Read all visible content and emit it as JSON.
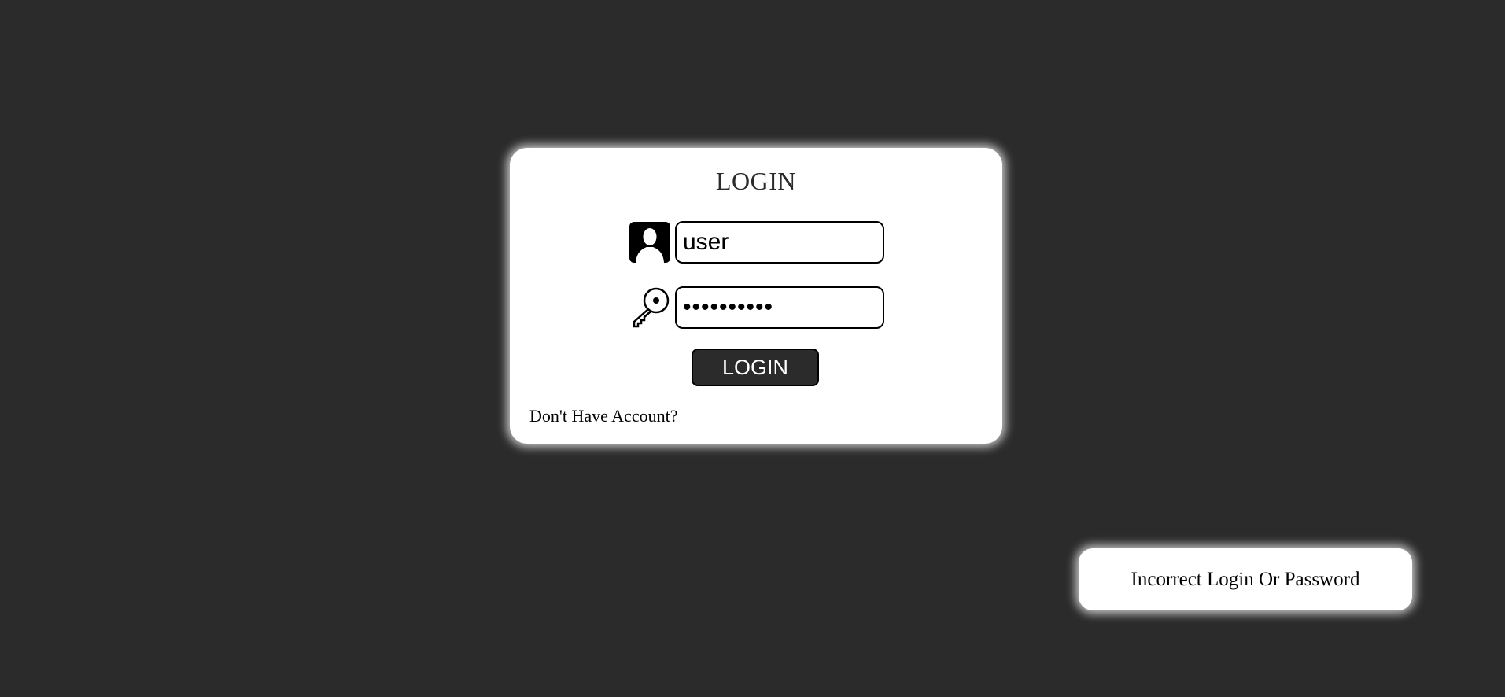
{
  "login_form": {
    "title": "LOGIN",
    "username_icon": "user-silhouette-icon",
    "username_value": "user",
    "password_icon": "key-icon",
    "password_value": "••••••••••",
    "submit_label": "LOGIN",
    "signup_link": "Don't Have Account?"
  },
  "notification": {
    "message": "Incorrect Login Or Password"
  },
  "colors": {
    "background": "#2b2b2b",
    "card": "#ffffff",
    "button": "#2b2b2b",
    "button_text": "#ffffff"
  }
}
